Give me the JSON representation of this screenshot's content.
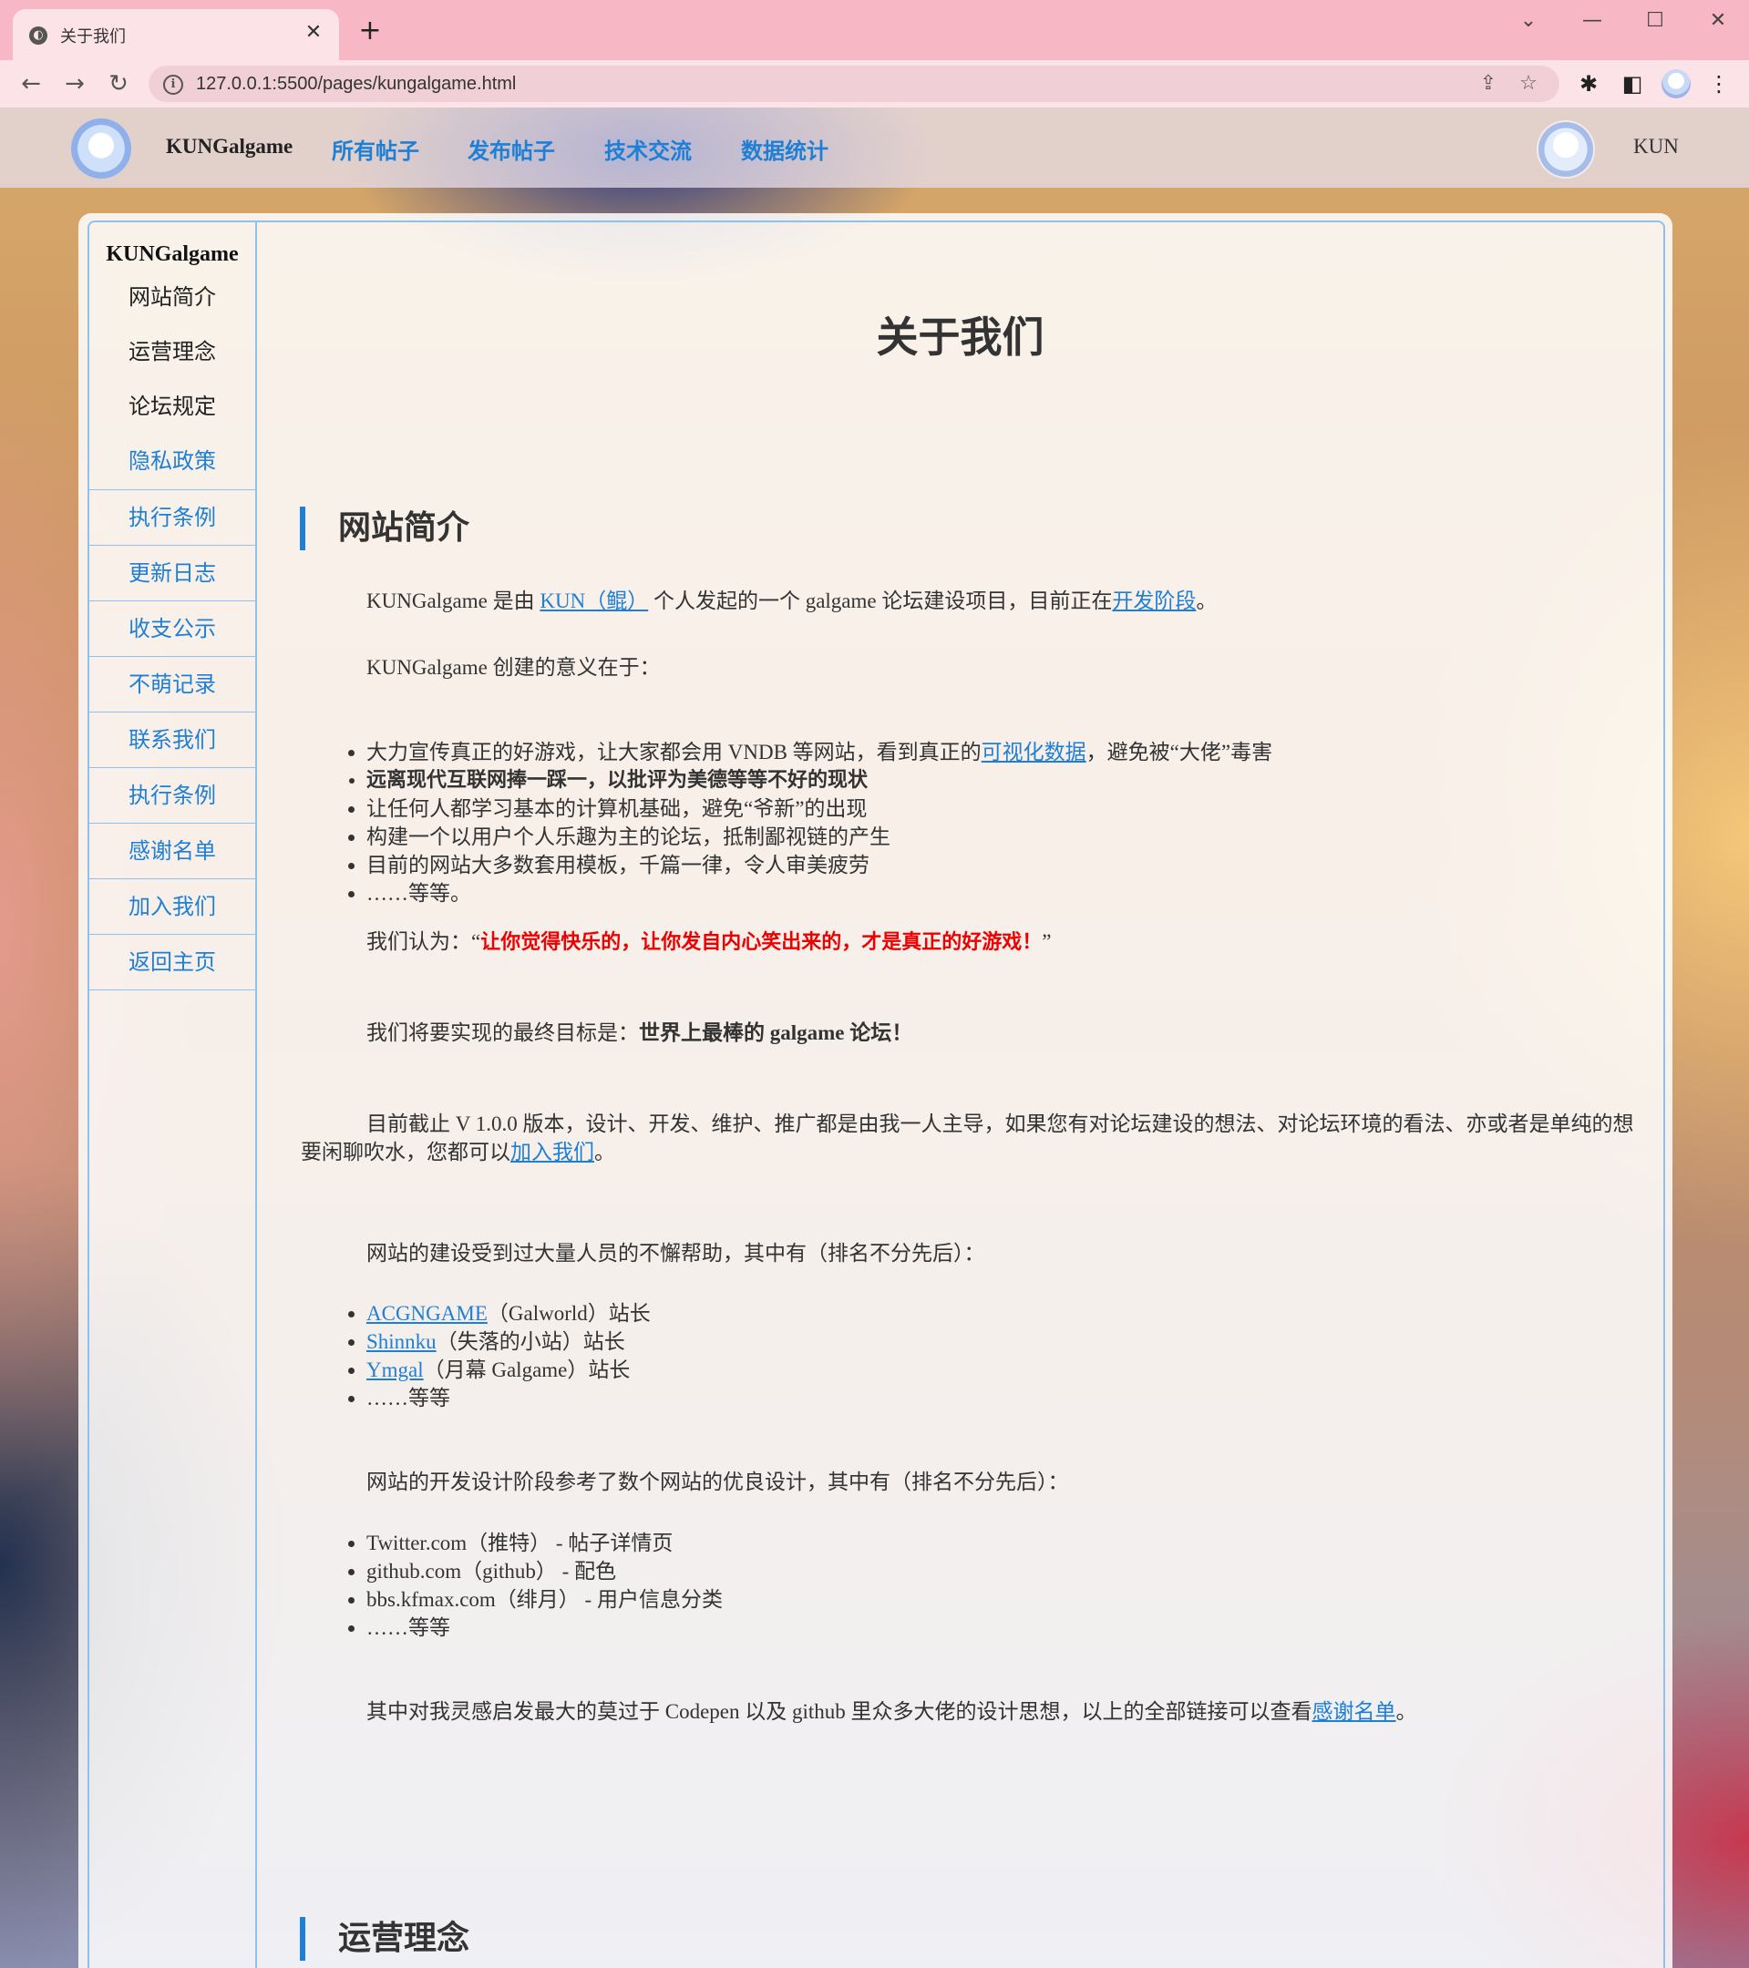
{
  "browser": {
    "tab_title": "关于我们",
    "url": "127.0.0.1:5500/pages/kungalgame.html"
  },
  "nav": {
    "brand": "KUNGalgame",
    "links": [
      "所有帖子",
      "发布帖子",
      "技术交流",
      "数据统计"
    ],
    "username": "KUN"
  },
  "sidebar": {
    "title": "KUNGalgame",
    "items": [
      "网站简介",
      "运营理念",
      "论坛规定",
      "隐私政策",
      "执行条例",
      "更新日志",
      "收支公示",
      "不萌记录",
      "联系我们",
      "执行条例",
      "感谢名单",
      "加入我们",
      "返回主页"
    ]
  },
  "content": {
    "page_title": "关于我们",
    "sections": [
      "网站简介",
      "运营理念"
    ],
    "intro": {
      "p1_a": "KUNGalgame 是由 ",
      "p1_link": "KUN（鲲）",
      "p1_b": " 个人发起的一个 galgame 论坛建设项目，目前正在",
      "p1_link2": "开发阶段",
      "p1_c": "。",
      "p2": "KUNGalgame 创建的意义在于：",
      "meaning_1_a": "大力宣传真正的好游戏，让大家都会用 VNDB 等网站，看到真正的",
      "meaning_1_link": "可视化数据",
      "meaning_1_b": "，避免被“大佬”毒害",
      "meaning_2": "远离现代互联网捧一踩一，以批评为美德等等不好的现状",
      "meaning_3": "让任何人都学习基本的计算机基础，避免“爷新”的出现",
      "meaning_4": "构建一个以用户个人乐趣为主的论坛，抵制鄙视链的产生",
      "meaning_5": "目前的网站大多数套用模板，千篇一律，令人审美疲劳",
      "meaning_6": "……等等。",
      "belief_a": "我们认为：“",
      "belief_red": "让你觉得快乐的，让你发自内心笑出来的，才是真正的好游戏！",
      "belief_b": "”",
      "goal_a": "我们将要实现的最终目标是：",
      "goal_b": "世界上最棒的 galgame 论坛！",
      "version_a": "目前截止 V 1.0.0 版本，设计、开发、维护、推广都是由我一人主导，如果您有对论坛建设的想法、对论坛环境的看法、亦或者是单纯的想要闲聊吹水，您都可以",
      "version_link": "加入我们",
      "version_b": "。",
      "helpers_intro": "网站的建设受到过大量人员的不懈帮助，其中有（排名不分先后）：",
      "helpers": [
        {
          "link": "ACGNGAME",
          "rest": "（Galworld）站长"
        },
        {
          "link": "Shinnku",
          "rest": "（失落的小站）站长"
        },
        {
          "link": "Ymgal",
          "rest": "（月幕 Galgame）站长"
        }
      ],
      "helpers_more": "……等等",
      "refs_intro": "网站的开发设计阶段参考了数个网站的优良设计，其中有（排名不分先后）：",
      "refs": [
        "Twitter.com（推特） - 帖子详情页",
        "github.com（github） - 配色",
        "bbs.kfmax.com（绯月） - 用户信息分类"
      ],
      "refs_more": "……等等",
      "inspire_a": "其中对我灵感启发最大的莫过于 Codepen 以及 github 里众多大佬的设计思想，以上的全部链接可以查看",
      "inspire_link": "感谢名单",
      "inspire_b": "。"
    }
  },
  "colors": {
    "accent": "#1e7fd6",
    "chrome_pink": "#f7b7c4",
    "highlight_red": "#ee0000"
  }
}
